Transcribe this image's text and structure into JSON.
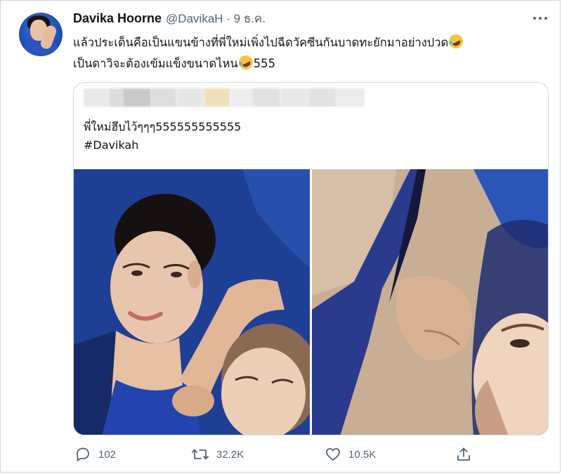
{
  "tweet": {
    "display_name": "Davika Hoorne",
    "handle_date": "@DavikaH · 9 ธ.ค.",
    "text_line1": "แล้วประเด็นคือเป็นแขนข้างที่พี่ใหม่เพิ่งไปฉีดวัคซีนกันบาดทะยักมาอย่างปวด",
    "text_line2_a": "เป็นดาวิจะต้องเข้มแข็งขนาดไหน",
    "text_line2_b": "555",
    "emoji_name": "rolling-on-floor-laughing-emoji"
  },
  "quoted_tweet": {
    "text_line1": "พี่ใหม่ฮึบไว้ๆๆๆ555555555555",
    "text_line2": "#Davikah"
  },
  "actions": {
    "reply_count": "102",
    "retweet_count": "32.2K",
    "like_count": "10.5K"
  },
  "colors": {
    "text_primary": "#0f1419",
    "text_secondary": "#536471",
    "border": "#cfd9de"
  }
}
